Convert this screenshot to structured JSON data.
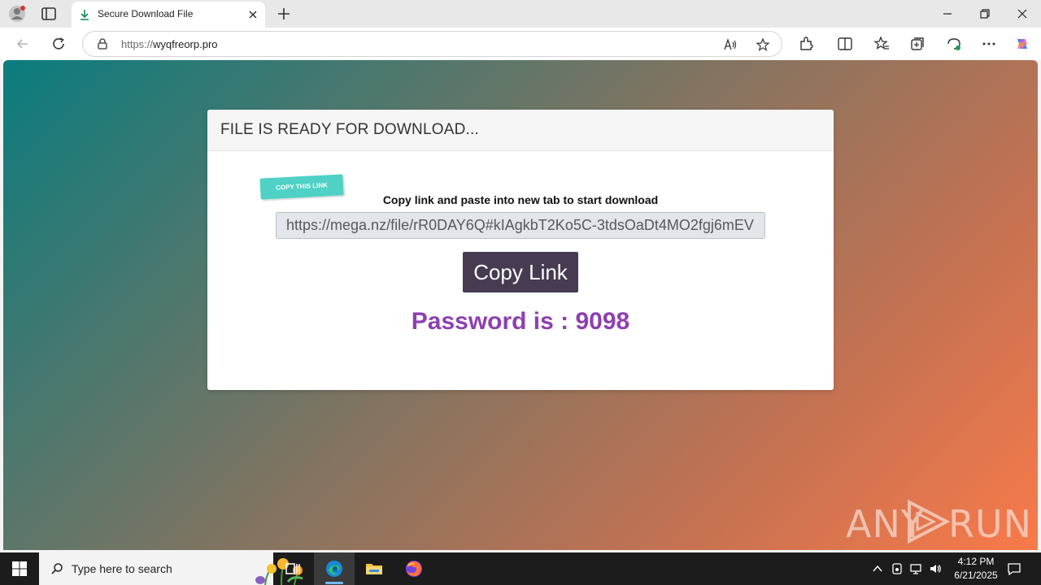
{
  "browser": {
    "tab": {
      "title": "Secure Download File"
    },
    "url": {
      "scheme": "https://",
      "host": "wyqfreorp.pro"
    }
  },
  "page": {
    "header_title": "FILE IS READY FOR DOWNLOAD...",
    "stamp_label": "COPY THIS LINK",
    "instruction": "Copy link and paste into new tab to start download",
    "link_value": "https://mega.nz/file/rR0DAY6Q#kIAgkbT2Ko5C-3tdsOaDt4MO2fgj6mEV",
    "copy_button_label": "Copy Link",
    "password_text": "Password is : 9098"
  },
  "watermark": {
    "text_left": "ANY",
    "text_right": "RUN"
  },
  "taskbar": {
    "search_placeholder": "Type here to search",
    "time": "4:12 PM",
    "date": "6/21/2025"
  },
  "colors": {
    "accent_button": "#473b52",
    "password": "#8e3fb0",
    "stamp": "#4fd1c5"
  }
}
